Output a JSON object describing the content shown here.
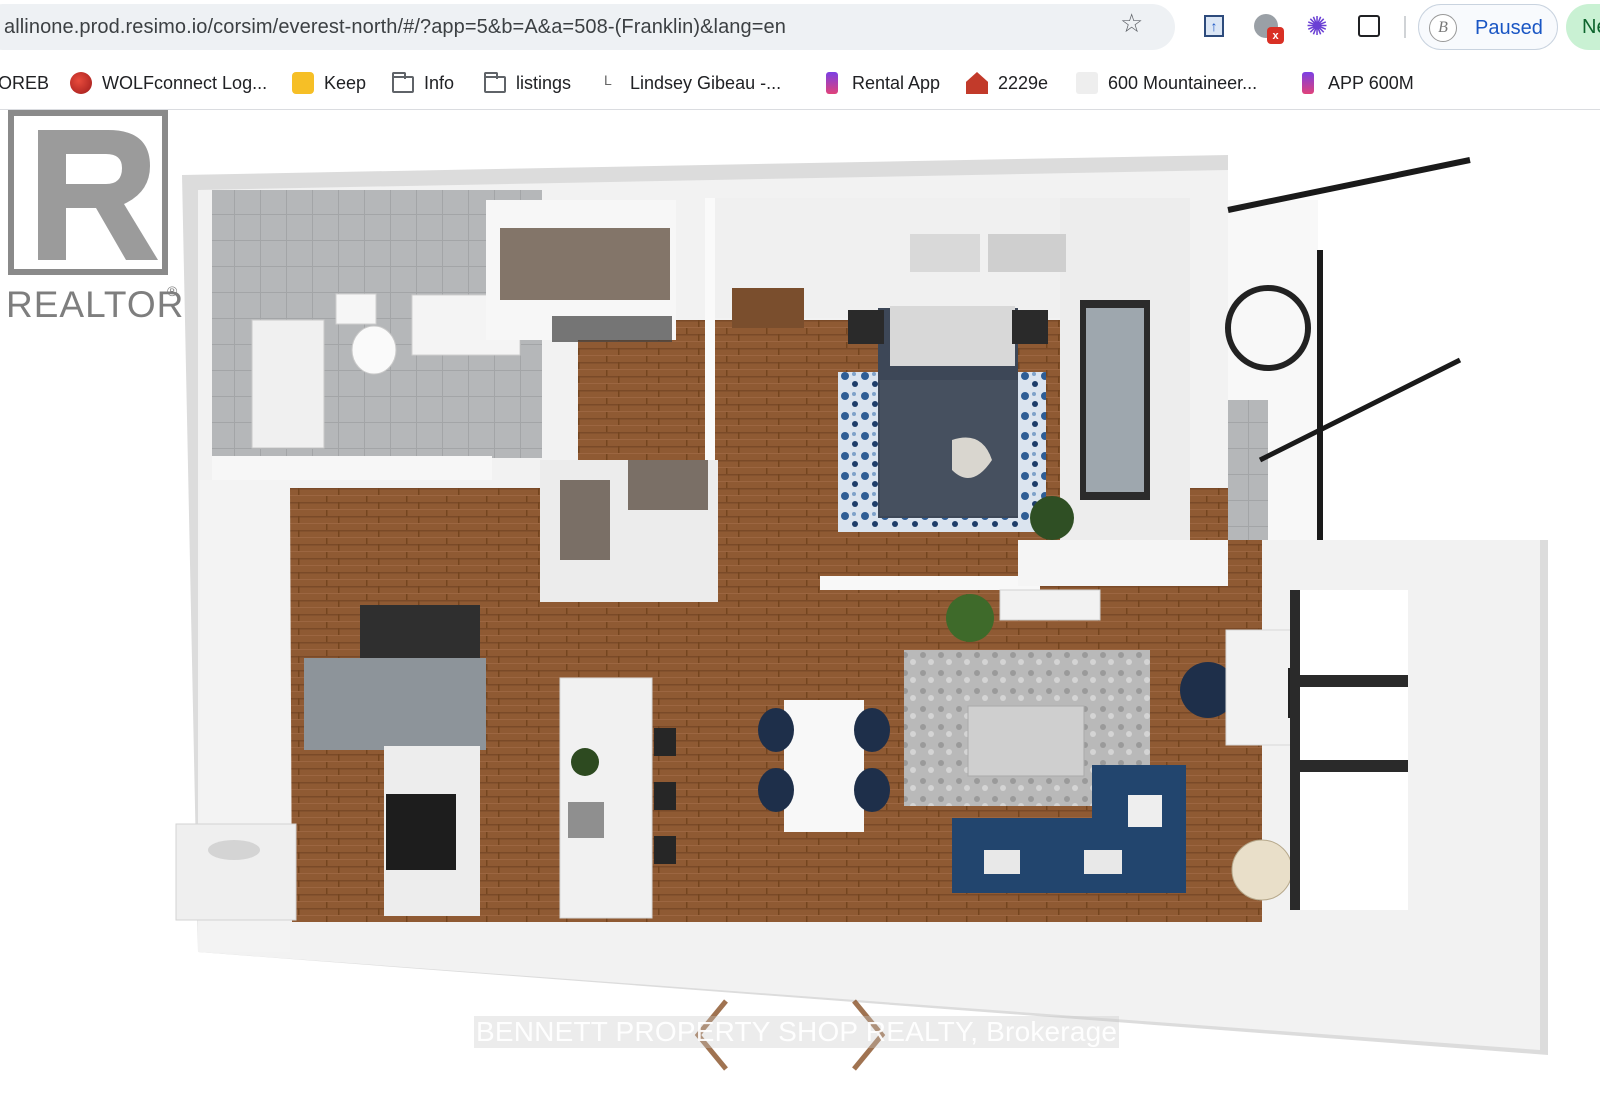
{
  "browser": {
    "url": "allinone.prod.resimo.io/corsim/everest-north/#/?app=5&b=A&a=508-(Franklin)&lang=en",
    "profile_status": "Paused",
    "new_button_label": "Ne",
    "notification_badge": "x",
    "extension_initial": "B"
  },
  "bookmarks": [
    {
      "label": "OREB",
      "icon": "none"
    },
    {
      "label": "WOLFconnect Log...",
      "icon": "wolf-icon"
    },
    {
      "label": "Keep",
      "icon": "keep-icon"
    },
    {
      "label": "Info",
      "icon": "folder-icon"
    },
    {
      "label": "listings",
      "icon": "folder-icon"
    },
    {
      "label": "Lindsey Gibeau -...",
      "icon": "ll-icon"
    },
    {
      "label": "Rental App",
      "icon": "phone-icon"
    },
    {
      "label": "2229e",
      "icon": "house-icon"
    },
    {
      "label": "600 Mountaineer...",
      "icon": "faint-icon"
    },
    {
      "label": "APP 600M",
      "icon": "phone-icon"
    }
  ],
  "listing": {
    "logo_text": "REALTOR",
    "logo_reg": "®",
    "watermark": "BENNETT PROPERTY SHOP REALTY, Brokerage",
    "image_description_icon": "3d-floor-plan-icon"
  },
  "colors": {
    "floor_wood": "#8f5a33",
    "wall": "#f4f4f4",
    "sofa": "#22456e",
    "accent": "#1a56c4",
    "new_tab_bg": "#c9f1d3"
  }
}
